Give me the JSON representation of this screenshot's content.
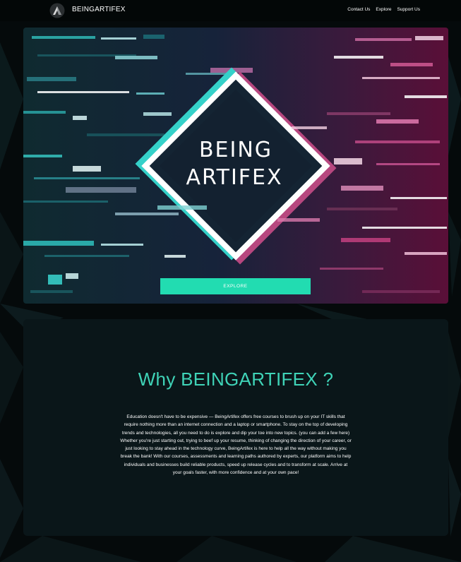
{
  "header": {
    "brand": "BEINGARTIFEX",
    "nav": [
      "Contact Us",
      "Explore",
      "Support Us"
    ]
  },
  "hero": {
    "graphic_line1": "BEING",
    "graphic_line2": "ARTIFEX",
    "cta_label": "EXPLORE"
  },
  "why": {
    "title": "Why BEINGARTIFEX ?",
    "body": "Education doesn't have to be expensive — BeingArtifex offers free courses to brush up on your IT skills that require nothing more than an internet connection and a laptop or smartphone. To stay on the top of developing trends and technologies, all you need to do is explore and dip your toe into new topics. (you can add a few here) Whether you're just starting out, trying to beef up your resume, thinking of changing the direction of your career, or just looking to stay ahead in the technology curve, BeingArtifex is here to help all the way without making you break the bank! With our courses, assessments and learning paths authored by experts, our platform aims to help individuals and businesses build reliable products, speed up release cycles and to transform at scale. Arrive at your goals faster, with more confidence and at your own pace!"
  },
  "colors": {
    "accent": "#22dcb1",
    "title": "#3fd3b7",
    "background": "#050a0b",
    "card": "#0a1619",
    "glitch_cyan": "#3ad6d0",
    "glitch_magenta": "#c2407f"
  }
}
